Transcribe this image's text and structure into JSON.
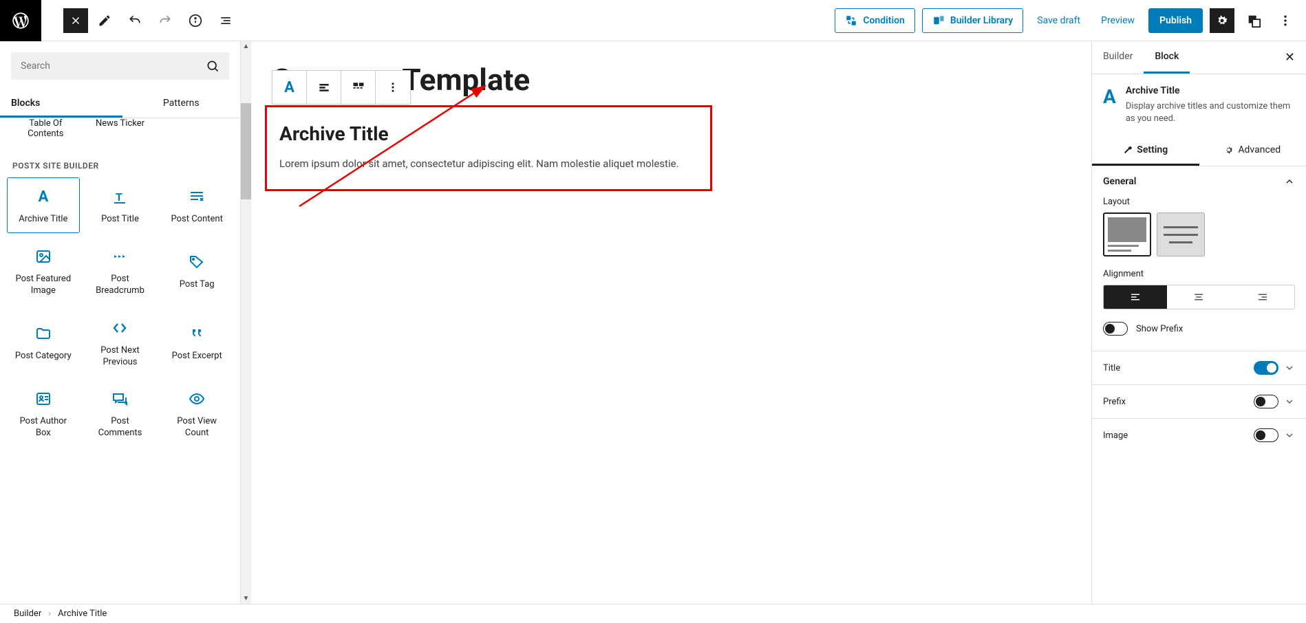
{
  "topbar": {
    "condition": "Condition",
    "builder_library": "Builder Library",
    "save_draft": "Save draft",
    "preview": "Preview",
    "publish": "Publish"
  },
  "search": {
    "placeholder": "Search"
  },
  "tabs": {
    "blocks": "Blocks",
    "patterns": "Patterns"
  },
  "truncated_items": {
    "a": "Table Of Contents",
    "b": "News Ticker"
  },
  "section_title": "POSTX SITE BUILDER",
  "blocks": [
    {
      "label": "Archive Title"
    },
    {
      "label": "Post Title"
    },
    {
      "label": "Post Content"
    },
    {
      "label": "Post Featured Image"
    },
    {
      "label": "Post Breadcrumb"
    },
    {
      "label": "Post Tag"
    },
    {
      "label": "Post Category"
    },
    {
      "label": "Post Next Previous"
    },
    {
      "label": "Post Excerpt"
    },
    {
      "label": "Post Author Box"
    },
    {
      "label": "Post Comments"
    },
    {
      "label": "Post View Count"
    }
  ],
  "canvas": {
    "bg_title": "Category Template",
    "block_title": "Archive Title",
    "block_desc": "Lorem ipsum dolor sit amet, consectetur adipiscing elit. Nam molestie aliquet molestie."
  },
  "right": {
    "tabs": {
      "builder": "Builder",
      "block": "Block"
    },
    "header": {
      "title": "Archive Title",
      "desc": "Display archive titles and customize them as you need."
    },
    "subtabs": {
      "setting": "Setting",
      "advanced": "Advanced"
    },
    "general": {
      "title": "General",
      "layout": "Layout",
      "alignment": "Alignment",
      "show_prefix": "Show Prefix"
    },
    "rows": {
      "title": "Title",
      "prefix": "Prefix",
      "image": "Image"
    }
  },
  "footer": {
    "a": "Builder",
    "b": "Archive Title"
  }
}
